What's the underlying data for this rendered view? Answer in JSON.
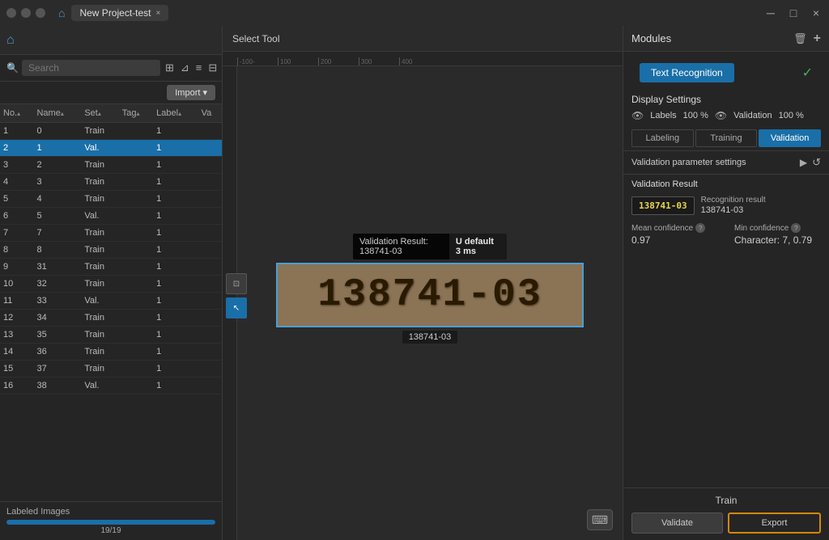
{
  "titleBar": {
    "projectName": "New Project-test",
    "closeLabel": "×",
    "minimizeLabel": "─",
    "maximizeLabel": "□",
    "closeWinLabel": "×"
  },
  "leftPanel": {
    "searchPlaceholder": "Search",
    "importLabel": "Import ▾",
    "columns": [
      {
        "id": "no",
        "label": "No."
      },
      {
        "id": "name",
        "label": "Name"
      },
      {
        "id": "set",
        "label": "Set"
      },
      {
        "id": "tag",
        "label": "Tag"
      },
      {
        "id": "label",
        "label": "Label"
      },
      {
        "id": "va",
        "label": "Va"
      }
    ],
    "rows": [
      {
        "no": "1",
        "name": "0",
        "set": "Train",
        "tag": "",
        "label": "1",
        "va": "",
        "selected": false
      },
      {
        "no": "2",
        "name": "1",
        "set": "Val.",
        "tag": "",
        "label": "1",
        "va": "",
        "selected": true
      },
      {
        "no": "3",
        "name": "2",
        "set": "Train",
        "tag": "",
        "label": "1",
        "va": "",
        "selected": false
      },
      {
        "no": "4",
        "name": "3",
        "set": "Train",
        "tag": "",
        "label": "1",
        "va": "",
        "selected": false
      },
      {
        "no": "5",
        "name": "4",
        "set": "Train",
        "tag": "",
        "label": "1",
        "va": "",
        "selected": false
      },
      {
        "no": "6",
        "name": "5",
        "set": "Val.",
        "tag": "",
        "label": "1",
        "va": "",
        "selected": false
      },
      {
        "no": "7",
        "name": "7",
        "set": "Train",
        "tag": "",
        "label": "1",
        "va": "",
        "selected": false
      },
      {
        "no": "8",
        "name": "8",
        "set": "Train",
        "tag": "",
        "label": "1",
        "va": "",
        "selected": false
      },
      {
        "no": "9",
        "name": "31",
        "set": "Train",
        "tag": "",
        "label": "1",
        "va": "",
        "selected": false
      },
      {
        "no": "10",
        "name": "32",
        "set": "Train",
        "tag": "",
        "label": "1",
        "va": "",
        "selected": false
      },
      {
        "no": "11",
        "name": "33",
        "set": "Val.",
        "tag": "",
        "label": "1",
        "va": "",
        "selected": false
      },
      {
        "no": "12",
        "name": "34",
        "set": "Train",
        "tag": "",
        "label": "1",
        "va": "",
        "selected": false
      },
      {
        "no": "13",
        "name": "35",
        "set": "Train",
        "tag": "",
        "label": "1",
        "va": "",
        "selected": false
      },
      {
        "no": "14",
        "name": "36",
        "set": "Train",
        "tag": "",
        "label": "1",
        "va": "",
        "selected": false
      },
      {
        "no": "15",
        "name": "37",
        "set": "Train",
        "tag": "",
        "label": "1",
        "va": "",
        "selected": false
      },
      {
        "no": "16",
        "name": "38",
        "set": "Val.",
        "tag": "",
        "label": "1",
        "va": "",
        "selected": false
      }
    ],
    "labeledImages": {
      "title": "Labeled Images",
      "progress": "19/19",
      "progressPct": 100
    }
  },
  "canvas": {
    "toolbarLabel": "Select Tool",
    "rulerTicks": [
      "-100-",
      "100",
      "200",
      "300",
      "400"
    ],
    "imageText": "138741-03",
    "labelText": "138741-03",
    "validationTooltip": "Validation Result: 138741-03",
    "validationBadge": "U default 3 ms"
  },
  "rightPanel": {
    "modulesTitle": "Modules",
    "textRecognitionLabel": "Text Recognition",
    "displaySettingsTitle": "Display Settings",
    "labelsLabel": "Labels",
    "labelsPct": "100 %",
    "validationLabel": "Validation",
    "validationPct": "100 %",
    "tabs": [
      {
        "label": "Labeling",
        "active": false
      },
      {
        "label": "Training",
        "active": false
      },
      {
        "label": "Validation",
        "active": true
      }
    ],
    "validationParamLabel": "Validation parameter settings",
    "validationResultTitle": "Validation Result",
    "resultBadge": "138741-03",
    "recognitionResultLabel": "Recognition result",
    "recognitionResultValue": "138741-03",
    "meanConfidenceLabel": "Mean confidence",
    "meanConfidenceHelp": "?",
    "meanConfidenceValue": "0.97",
    "minConfidenceLabel": "Min confidence",
    "minConfidenceHelp": "?",
    "minConfidenceValue": "Character: 7, 0.79",
    "trainLabel": "Train",
    "validateLabel": "Validate",
    "exportLabel": "Export"
  }
}
